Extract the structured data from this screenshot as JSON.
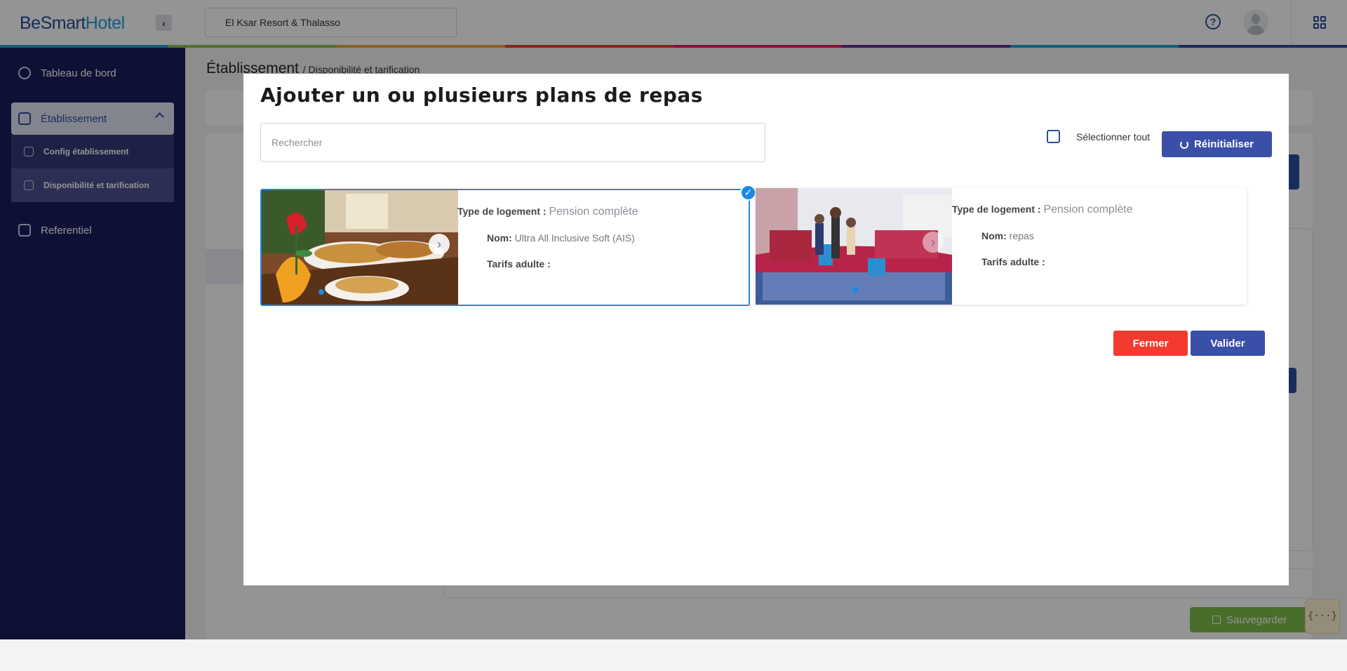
{
  "brand": {
    "logo_be": "Be",
    "logo_smart": "Smart",
    "logo_hotel": "Hotel"
  },
  "header": {
    "hotel_select": "El Ksar Resort & Thalasso",
    "help_icon": "question-circle-icon",
    "apps_icon": "grid-icon"
  },
  "rainbow_colors": [
    "#1ea0d8",
    "#8bc34a",
    "#f0a33a",
    "#e0452b",
    "#e91e63",
    "#6a2c91",
    "#1ea0d8",
    "#2a4f9e"
  ],
  "sidebar": {
    "items": [
      {
        "label": "Tableau de bord",
        "icon": "dashboard-icon"
      },
      {
        "label": "Établissement",
        "icon": "building-icon"
      },
      {
        "label": "Referentiel",
        "icon": "book-icon"
      }
    ],
    "sub_items": [
      {
        "label": "Config établissement",
        "icon": "building-config-icon"
      },
      {
        "label": "Disponibilité et tarification",
        "icon": "building-pricing-icon"
      }
    ]
  },
  "page": {
    "title": "Établissement",
    "breadcrumb": "/ Disponibilité et tarification",
    "save_label": "Sauvegarder",
    "code_label": "{···}"
  },
  "modal": {
    "title": "Ajouter un ou plusieurs plans de repas",
    "search_placeholder": "Rechercher",
    "select_all_label": "Sélectionner tout",
    "reset_label": "Réinitialiser",
    "close_label": "Fermer",
    "validate_label": "Valider",
    "cards": [
      {
        "selected": true,
        "type_label": "Type de logement :",
        "type_value": "Pension complète",
        "name_label": "Nom:",
        "name_value": "Ultra All Inclusive Soft (AIS)",
        "tarif_label": "Tarifs adulte :"
      },
      {
        "selected": false,
        "type_label": "Type de logement :",
        "type_value": "Pension complète",
        "name_label": "Nom:",
        "name_value": "repas",
        "tarif_label": "Tarifs adulte :"
      }
    ]
  },
  "colors": {
    "sidebar_bg": "#1b1d5e",
    "primary": "#3a4fa8",
    "danger": "#f4392f",
    "selected_border": "#1e88e5",
    "save_green": "#7fbe4a"
  }
}
